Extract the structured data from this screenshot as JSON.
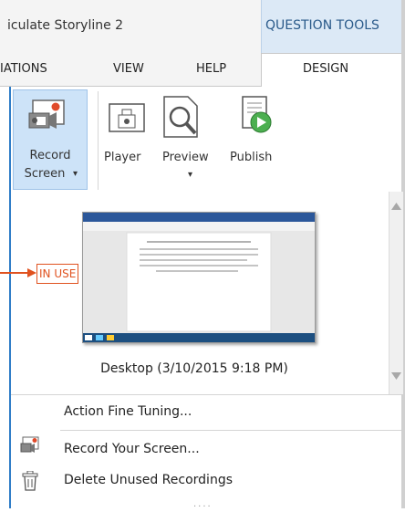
{
  "titlebar": {
    "app_title": "iculate Storyline 2",
    "context_group": "QUESTION TOOLS"
  },
  "tabs": [
    {
      "label": "IATIONS"
    },
    {
      "label": "VIEW"
    },
    {
      "label": "HELP"
    },
    {
      "label": "DESIGN"
    }
  ],
  "ribbon": {
    "record_screen_line1": "Record",
    "record_screen_line2": "Screen",
    "player": "Player",
    "preview": "Preview",
    "publish": "Publish",
    "dropdown_glyph": "▾"
  },
  "gallery": {
    "status_badge": "IN USE",
    "caption": "Desktop (3/10/2015 9:18 PM)",
    "arrow_color": "#e0521f"
  },
  "menu": {
    "items": [
      {
        "label": "Action Fine Tuning...",
        "icon": null
      },
      {
        "label": "Record Your Screen...",
        "icon": "record-screen-icon"
      },
      {
        "label": "Delete Unused Recordings",
        "icon": "trash-icon"
      }
    ],
    "grip": "····"
  },
  "colors": {
    "accent": "#2f7dc7",
    "context_tab_bg": "#dce9f6",
    "selected_btn_bg": "#cde3f8",
    "badge": "#e0521f"
  }
}
